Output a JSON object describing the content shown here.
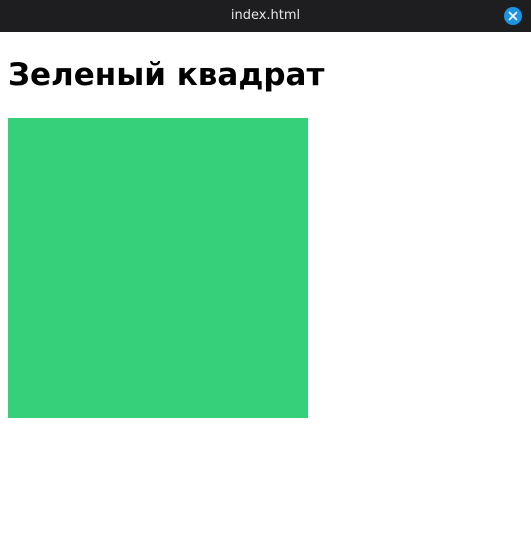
{
  "window": {
    "title": "index.html",
    "close_icon": "close-icon",
    "close_button_color": "#1c95e0",
    "titlebar_color": "#1e1e21"
  },
  "page": {
    "heading": "Зеленый квадрат",
    "square_color": "#36d07a"
  }
}
